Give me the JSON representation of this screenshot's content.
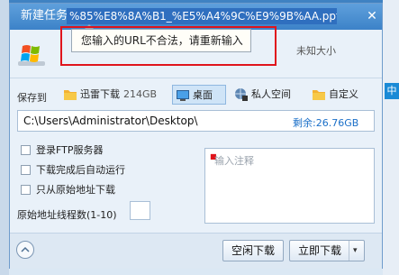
{
  "dialog": {
    "title": "新建任务",
    "url_value": "%85%E8%8A%B1_%E5%A4%9C%E9%9B%AA.ppt",
    "close_glyph": "✕"
  },
  "tooltip": {
    "message": "您输入的URL不合法，请重新输入"
  },
  "file": {
    "icon": "windows-logo-icon",
    "size": "未知大小"
  },
  "save": {
    "label": "保存到",
    "locations": [
      {
        "label": "迅雷下载",
        "sub": "214GB",
        "icon": "folder-icon",
        "selected": false
      },
      {
        "label": "桌面",
        "sub": "",
        "icon": "monitor-icon",
        "selected": true
      },
      {
        "label": "私人空间",
        "sub": "",
        "icon": "globe-lock-icon",
        "selected": false
      },
      {
        "label": "自定义",
        "sub": "",
        "icon": "folder-icon",
        "selected": false
      }
    ],
    "path": "C:\\Users\\Administrator\\Desktop\\",
    "free": "剩余:26.76GB"
  },
  "options": {
    "ftp": "登录FTP服务器",
    "auto_run": "下载完成后自动运行",
    "only_original": "只从原始地址下载",
    "threads_label": "原始地址线程数(1-10)",
    "threads_value": ""
  },
  "comment": {
    "placeholder": "输入注释"
  },
  "footer": {
    "idle_download": "空闲下载",
    "download_now": "立即下载",
    "split_glyph": "▾"
  },
  "background": {
    "side_tag": "中"
  },
  "colors": {
    "titlebar": "#4a8fd2",
    "accent": "#1a6fc8",
    "highlight_box": "#e0141c"
  }
}
